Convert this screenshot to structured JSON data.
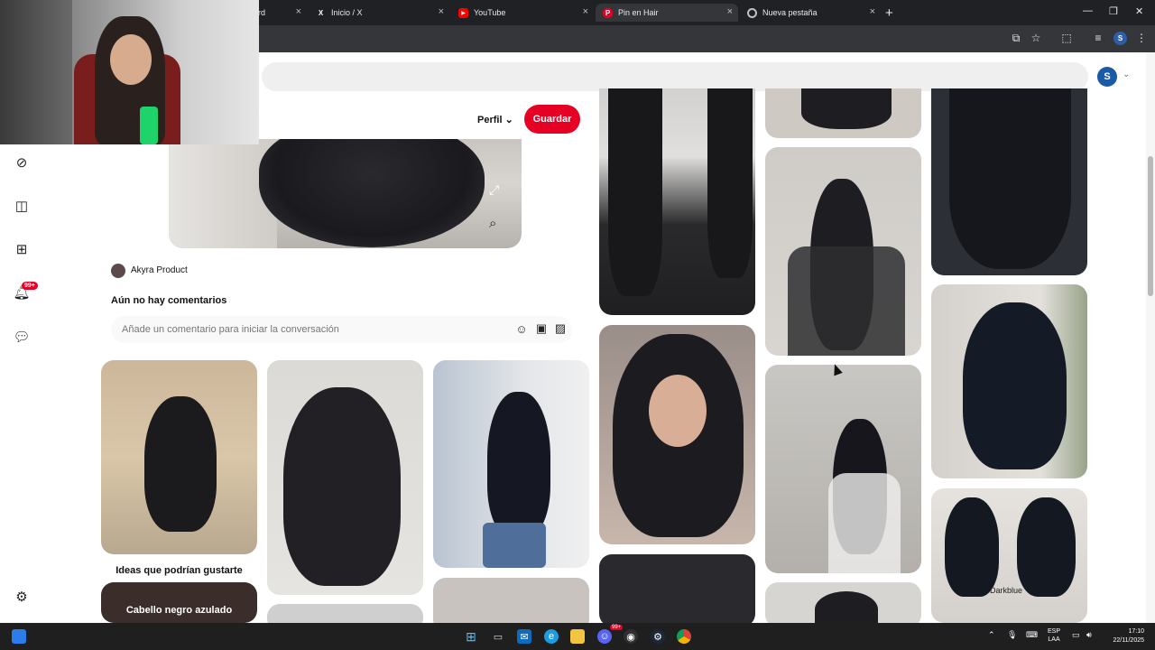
{
  "browser": {
    "tabs": [
      {
        "title": "rd",
        "icon": "tab-icon",
        "active": false
      },
      {
        "title": "Inicio / X",
        "icon": "x-icon",
        "active": false
      },
      {
        "title": "YouTube",
        "icon": "youtube-icon",
        "active": false
      },
      {
        "title": "Pin en Hair",
        "icon": "pinterest-icon",
        "active": true
      },
      {
        "title": "Nueva pestaña",
        "icon": "chrome-icon",
        "active": false
      }
    ],
    "profile_initial": "S"
  },
  "pinterest": {
    "user_initial": "S",
    "header": {
      "profile_label": "Perfil",
      "save_label": "Guardar"
    },
    "pin": {
      "author": "Akyra Product",
      "comments_title": "Aún no hay comentarios",
      "comment_placeholder": "Añade un comentario para iniciar la conversación"
    },
    "nav_badge": "99+",
    "feed": {
      "ideas_label": "Ideas que podrían gustarte",
      "tile_label": "Cabello negro azulado",
      "darkblue_caption": "Darkblue"
    }
  },
  "taskbar": {
    "chat_badge": "99+",
    "language": "ESP",
    "keyboard": "LAA",
    "time": "17:10",
    "date": "22/11/2025"
  },
  "colors": {
    "pinterest_red": "#e60023",
    "chrome_dark": "#202124",
    "toolbar": "#35363a"
  }
}
